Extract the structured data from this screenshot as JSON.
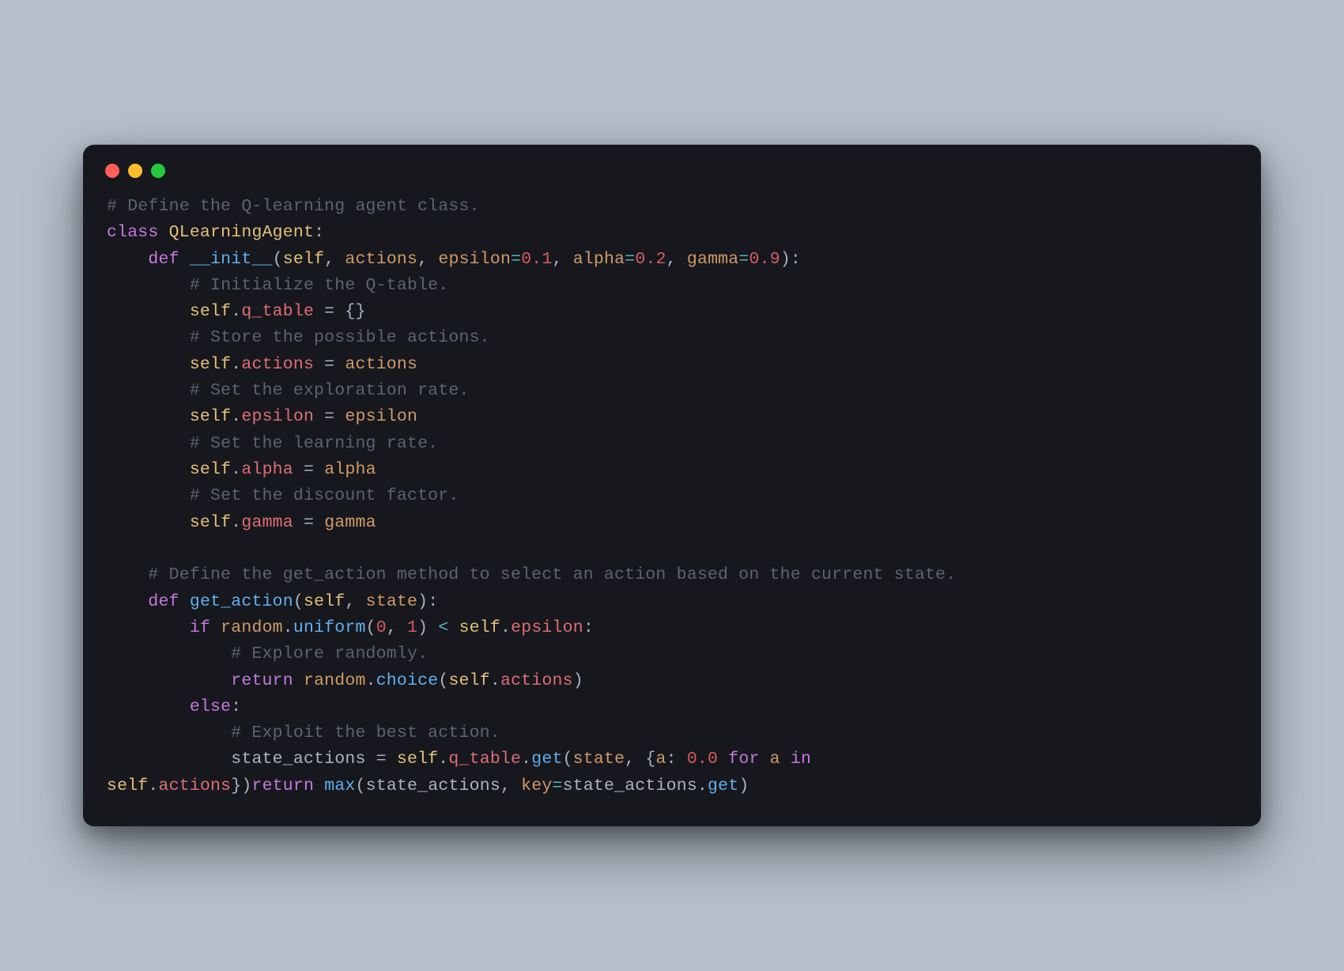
{
  "window": {
    "traffic_lights": [
      "close",
      "minimize",
      "zoom"
    ]
  },
  "code": {
    "l1": "# Define the Q-learning agent class.",
    "l2_kw": "class",
    "l2_cls": "QLearningAgent",
    "l2_colon": ":",
    "l3_indent": "    ",
    "l3_kw": "def",
    "l3_fn": "__init__",
    "l3_open": "(",
    "l3_self": "self",
    "l3_c1": ", ",
    "l3_p1": "actions",
    "l3_c2": ", ",
    "l3_p2": "epsilon",
    "l3_eq1": "=",
    "l3_v1": "0.1",
    "l3_c3": ", ",
    "l3_p3": "alpha",
    "l3_eq2": "=",
    "l3_v2": "0.2",
    "l3_c4": ", ",
    "l3_p4": "gamma",
    "l3_eq3": "=",
    "l3_v3": "0.9",
    "l3_close": "):",
    "l4": "        # Initialize the Q-table.",
    "l5_indent": "        ",
    "l5_self": "self",
    "l5_dot": ".",
    "l5_attr": "q_table",
    "l5_eq": " = ",
    "l5_val": "{}",
    "l6": "        # Store the possible actions.",
    "l7_indent": "        ",
    "l7_self": "self",
    "l7_dot": ".",
    "l7_attr": "actions",
    "l7_eq": " = ",
    "l7_val": "actions",
    "l8": "        # Set the exploration rate.",
    "l9_indent": "        ",
    "l9_self": "self",
    "l9_dot": ".",
    "l9_attr": "epsilon",
    "l9_eq": " = ",
    "l9_val": "epsilon",
    "l10": "        # Set the learning rate.",
    "l11_indent": "        ",
    "l11_self": "self",
    "l11_dot": ".",
    "l11_attr": "alpha",
    "l11_eq": " = ",
    "l11_val": "alpha",
    "l12": "        # Set the discount factor.",
    "l13_indent": "        ",
    "l13_self": "self",
    "l13_dot": ".",
    "l13_attr": "gamma",
    "l13_eq": " = ",
    "l13_val": "gamma",
    "l14": "",
    "l15": "    # Define the get_action method to select an action based on the current state.",
    "l16_indent": "    ",
    "l16_kw": "def",
    "l16_fn": "get_action",
    "l16_open": "(",
    "l16_self": "self",
    "l16_c1": ", ",
    "l16_p1": "state",
    "l16_close": "):",
    "l17_indent": "        ",
    "l17_kw": "if",
    "l17_sp": " ",
    "l17_rand": "random",
    "l17_dot1": ".",
    "l17_uni": "uniform",
    "l17_open": "(",
    "l17_a0": "0",
    "l17_c1": ", ",
    "l17_a1": "1",
    "l17_close": ")",
    "l17_lt": " < ",
    "l17_self": "self",
    "l17_dot2": ".",
    "l17_eps": "epsilon",
    "l17_colon": ":",
    "l18": "            # Explore randomly.",
    "l19_indent": "            ",
    "l19_kw": "return",
    "l19_sp": " ",
    "l19_rand": "random",
    "l19_dot": ".",
    "l19_choice": "choice",
    "l19_open": "(",
    "l19_self": "self",
    "l19_dot2": ".",
    "l19_act": "actions",
    "l19_close": ")",
    "l20_indent": "        ",
    "l20_kw": "else",
    "l20_colon": ":",
    "l21": "            # Exploit the best action.",
    "l22_indent": "            ",
    "l22_sa": "state_actions",
    "l22_eq": " = ",
    "l22_self": "self",
    "l22_dot1": ".",
    "l22_qt": "q_table",
    "l22_dot2": ".",
    "l22_get": "get",
    "l22_open": "(",
    "l22_state": "state",
    "l22_c1": ", ",
    "l22_br": "{",
    "l22_a": "a",
    "l22_colon": ": ",
    "l22_zero": "0.0",
    "l22_sp": " ",
    "l22_for": "for",
    "l22_sp2": " ",
    "l22_a2": "a",
    "l22_sp3": " ",
    "l22_in": "in",
    "l23_self": "self",
    "l23_dot": ".",
    "l23_act": "actions",
    "l23_close": "})",
    "l23b_kw": "return",
    "l23b_sp": " ",
    "l23b_max": "max",
    "l23b_open": "(",
    "l23b_sa": "state_actions",
    "l23b_c1": ", ",
    "l23b_key": "key",
    "l23b_eq": "=",
    "l23b_sa2": "state_actions",
    "l23b_dot": ".",
    "l23b_get": "get",
    "l23b_close": ")"
  }
}
